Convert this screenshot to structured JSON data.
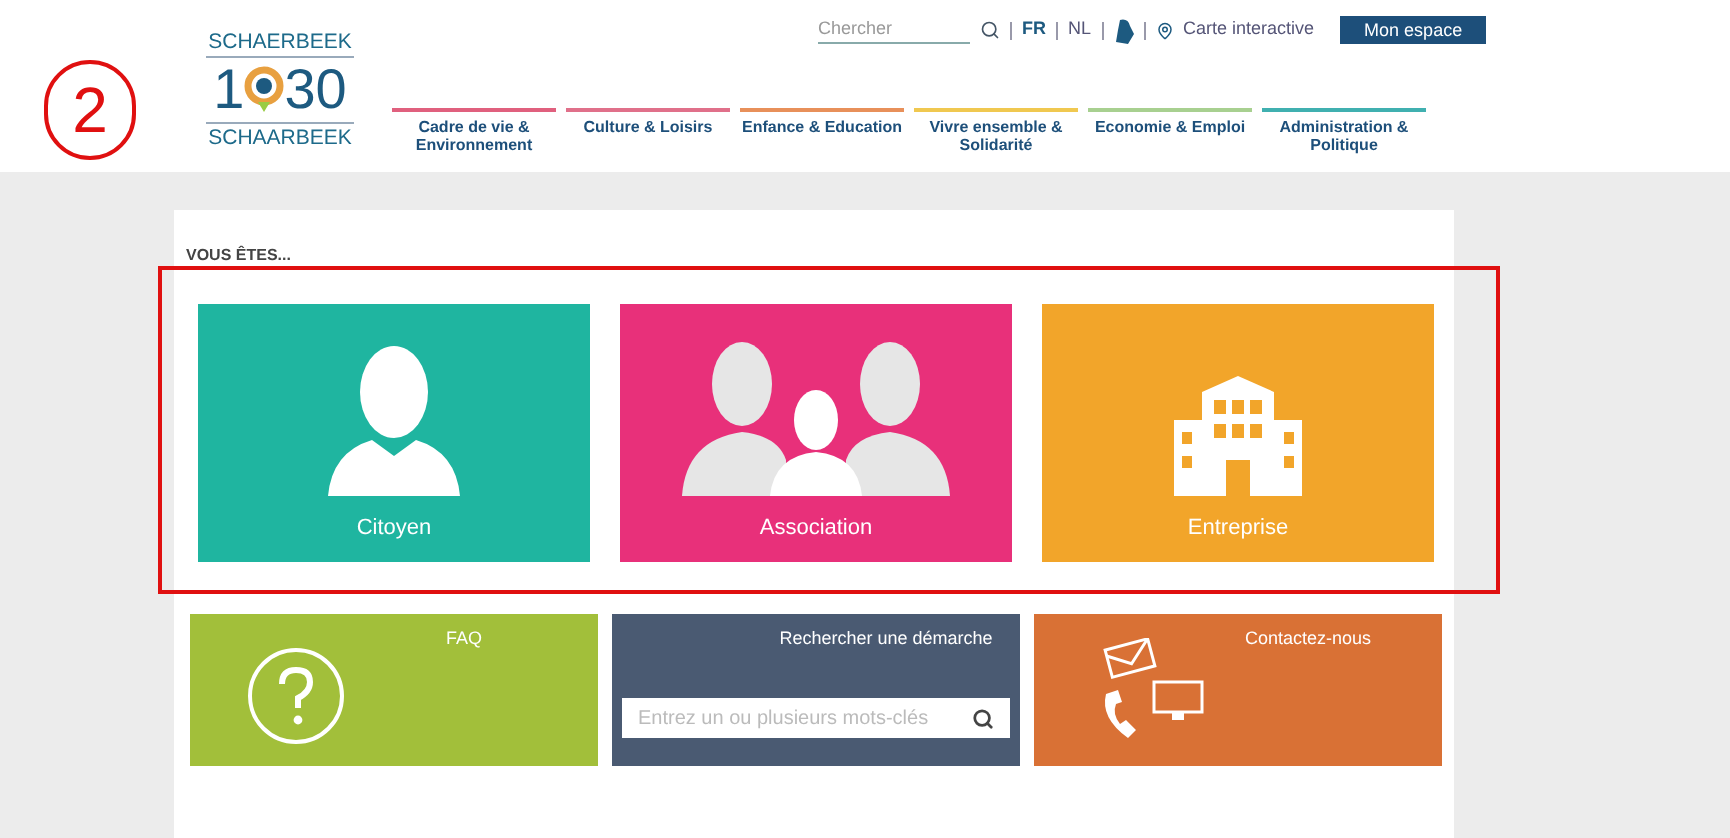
{
  "annotation": {
    "label": "2"
  },
  "logo": {
    "top": "SCHAERBEEK",
    "number_start": "1",
    "number_end": "30",
    "bottom": "SCHAARBEEK"
  },
  "topbar": {
    "search": {
      "placeholder": "Chercher"
    },
    "languages": [
      {
        "label": "FR",
        "selected": true
      },
      {
        "label": "NL",
        "selected": false
      }
    ],
    "map_link": "Carte interactive",
    "account_button": "Mon espace"
  },
  "nav": [
    {
      "label": "Cadre de vie & Environnement",
      "color": "#e0607e"
    },
    {
      "label": "Culture & Loisirs",
      "color": "#e0708a"
    },
    {
      "label": "Enfance & Education",
      "color": "#e8905a"
    },
    {
      "label": "Vivre ensemble & Solidarité",
      "color": "#f0c850"
    },
    {
      "label": "Economie & Emploi",
      "color": "#a8d090"
    },
    {
      "label": "Administration & Politique",
      "color": "#40b0b0"
    }
  ],
  "section_title": "VOUS ÊTES...",
  "profiles": [
    {
      "kind": "person",
      "label": "Citoyen",
      "color": "#1fb5a0"
    },
    {
      "kind": "group",
      "label": "Association",
      "color": "#e8307a"
    },
    {
      "kind": "building",
      "label": "Entreprise",
      "color": "#f2a52a"
    }
  ],
  "services": [
    {
      "kind": "faq",
      "title": "FAQ",
      "color": "#a2bf3a"
    },
    {
      "kind": "search",
      "title": "Rechercher une démarche",
      "color": "#4a5a72",
      "placeholder": "Entrez un ou plusieurs mots-clés"
    },
    {
      "kind": "contact",
      "title": "Contactez-nous",
      "color": "#d97135"
    }
  ]
}
